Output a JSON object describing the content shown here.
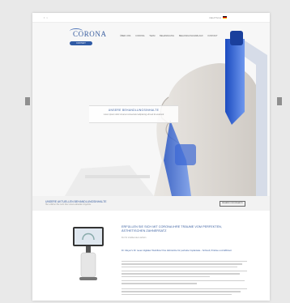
{
  "topbar": {
    "left": "f  t",
    "right": "DEUTSCH"
  },
  "logo": "CORONA",
  "cta": "KONTAKT",
  "nav": [
    "ÜBER UNS",
    "CORONA",
    "TEAM",
    "BEHANDLUNG",
    "BEHANDLUNGSABLAUF",
    "KONTAKT"
  ],
  "hero": {
    "box_title": "UNSERE BEHANDLUNGSINHALTE",
    "box_text": "Lorem ipsum dolor sit amet consectetur adipiscing elit sed do eiusmod"
  },
  "strip": {
    "title": "UNSERE AKTUELLEN BEHANDLUNGSINHALTE",
    "text": "Hier erfahren Sie mehr über unsere aktuellen Angebote",
    "button": "BEHANDLUNGSINHALTE"
  },
  "main": {
    "heading": "ERFÜLLEN SIE SICH MIT CORONA IHRE TRÄUME VOM PERFEKTEN, ÄSTHETISCHEN ZAHNERSATZ",
    "sub": "Für Ihr strahlendes Lächeln",
    "subheading": "Dr. Meyer's Ihr neuer digitaler Workflow! Ihre Zahnärzte für perfekte Implantate - Schnell, Präzise und Effizient"
  },
  "colors": {
    "brand": "#2f5aa5",
    "accent_blue": "#1f55c4",
    "bg": "#e9e9e9"
  }
}
